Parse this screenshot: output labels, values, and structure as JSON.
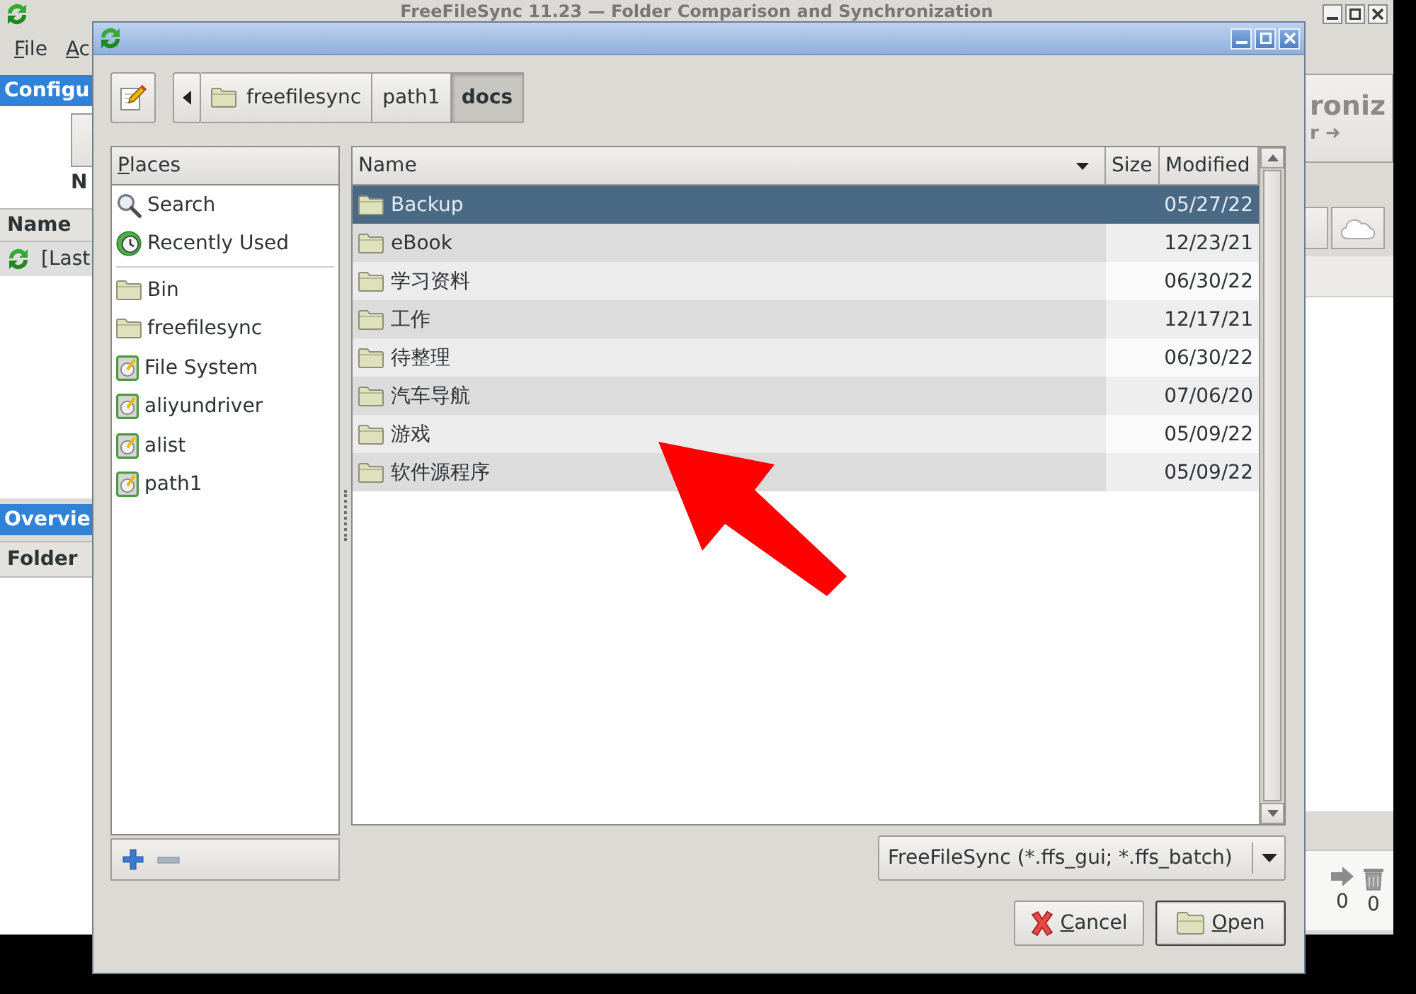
{
  "main_window": {
    "title": "FreeFileSync 11.23 — Folder Comparison and Synchronization",
    "menu": [
      {
        "label": "File",
        "mnemonic": true
      },
      {
        "label": "Ac",
        "mnemonic": true
      }
    ],
    "config_panel": {
      "title": "Configu",
      "button_label": "N",
      "column": "Name",
      "rows": [
        {
          "label": "[Last",
          "selected": true
        }
      ]
    },
    "overview_panel": {
      "title": "Overvie",
      "column": "Folder"
    },
    "sync_button": {
      "label": "roniz",
      "sublabel": "r ➜"
    },
    "counts": [
      {
        "kind": "update",
        "value": "0"
      },
      {
        "kind": "delete",
        "value": "0"
      }
    ]
  },
  "dialog": {
    "path_bar": [
      {
        "label": "freefilesync",
        "kind": "folder",
        "selected": false
      },
      {
        "label": "path1",
        "kind": "plain",
        "selected": false
      },
      {
        "label": "docs",
        "kind": "plain",
        "selected": true
      }
    ],
    "places": {
      "title": "Places",
      "mnemonic": true,
      "groups": [
        [
          {
            "label": "Search",
            "kind": "search",
            "selected": false
          },
          {
            "label": "Recently Used",
            "kind": "recent",
            "selected": false
          }
        ],
        [
          {
            "label": "Bin",
            "kind": "folder",
            "selected": false
          },
          {
            "label": "freefilesync",
            "kind": "folder",
            "selected": false
          },
          {
            "label": "File System",
            "kind": "drive",
            "selected": false
          },
          {
            "label": "aliyundriver",
            "kind": "drive",
            "selected": false
          },
          {
            "label": "alist",
            "kind": "drive",
            "selected": false
          },
          {
            "label": "path1",
            "kind": "drive",
            "selected": false
          }
        ]
      ],
      "actions": [
        {
          "kind": "add",
          "disabled": false
        },
        {
          "kind": "remove",
          "disabled": true
        }
      ]
    },
    "files": {
      "columns": [
        {
          "label": "Name",
          "sorted": true
        },
        {
          "label": "Size",
          "sorted": false
        },
        {
          "label": "Modified",
          "sorted": false
        }
      ],
      "rows": [
        {
          "name": "Backup",
          "modified": "05/27/22",
          "selected": true
        },
        {
          "name": "eBook",
          "modified": "12/23/21",
          "selected": false
        },
        {
          "name": "学习资料",
          "modified": "06/30/22",
          "selected": false
        },
        {
          "name": "工作",
          "modified": "12/17/21",
          "selected": false
        },
        {
          "name": "待整理",
          "modified": "06/30/22",
          "selected": false
        },
        {
          "name": "汽车导航",
          "modified": "07/06/20",
          "selected": false
        },
        {
          "name": "游戏",
          "modified": "05/09/22",
          "selected": false
        },
        {
          "name": "软件源程序",
          "modified": "05/09/22",
          "selected": false
        }
      ]
    },
    "filter": "FreeFileSync (*.ffs_gui; *.ffs_batch)",
    "buttons": [
      {
        "label": "Cancel",
        "kind": "cancel",
        "mnemonic": true,
        "default": false
      },
      {
        "label": "Open",
        "kind": "open",
        "mnemonic": true,
        "default": true
      }
    ]
  },
  "annotations": [
    {
      "kind": "arrow"
    }
  ]
}
